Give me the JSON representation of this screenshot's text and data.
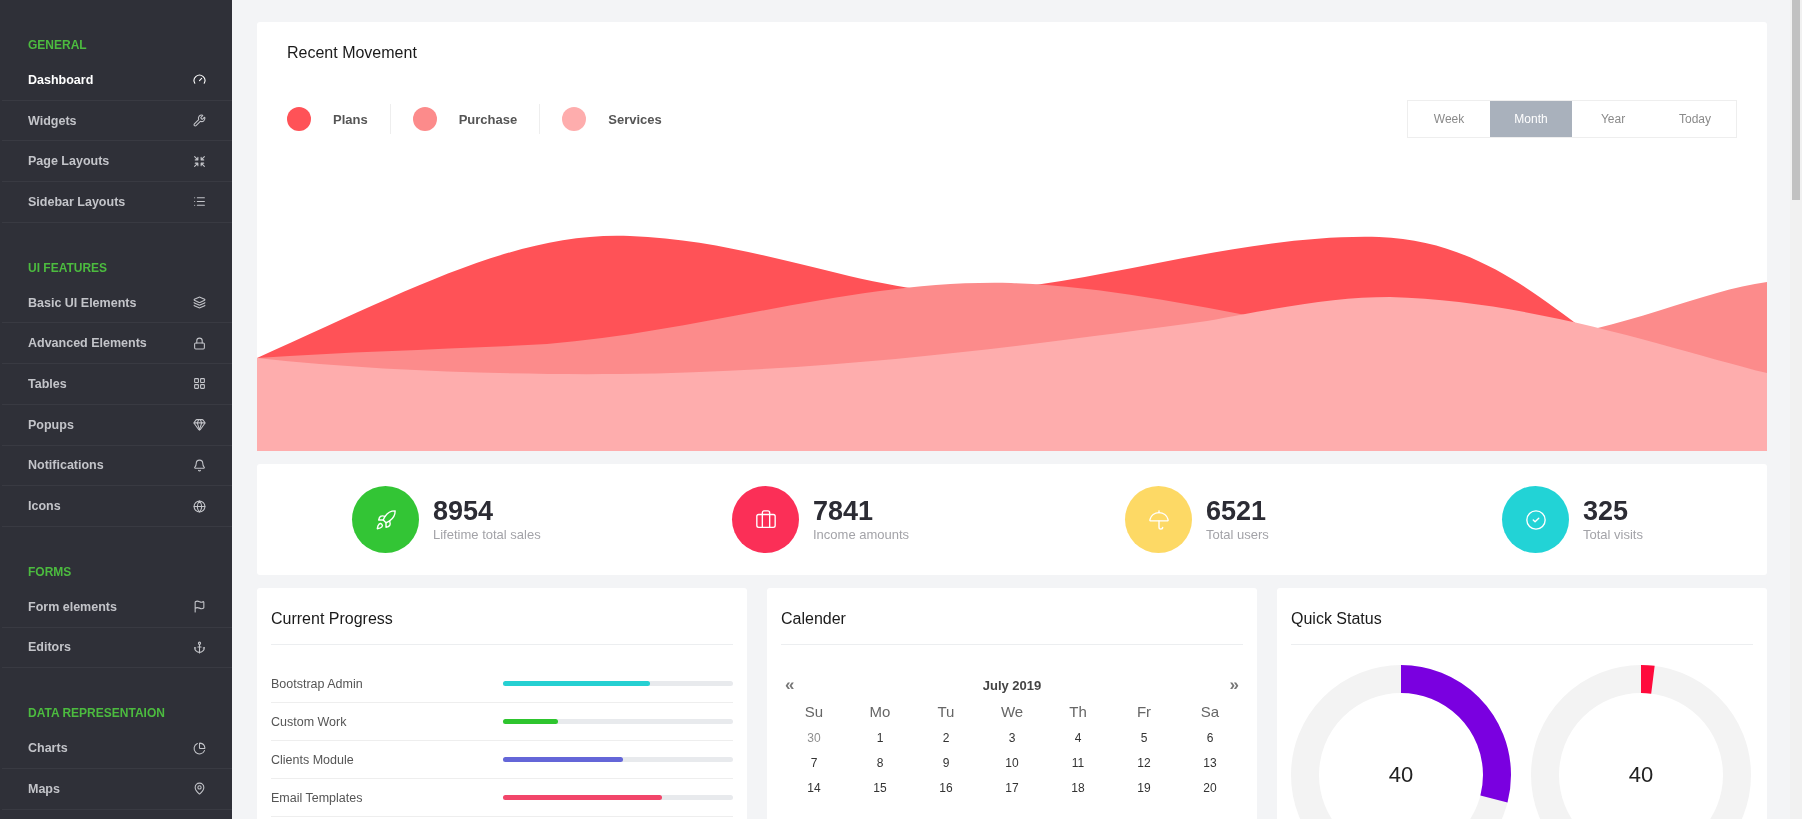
{
  "sidebar": {
    "sections": [
      {
        "title": "GENERAL",
        "items": [
          {
            "label": "Dashboard",
            "selected": true
          },
          {
            "label": "Widgets",
            "selected": false
          },
          {
            "label": "Page Layouts",
            "selected": false
          },
          {
            "label": "Sidebar Layouts",
            "selected": false
          }
        ]
      },
      {
        "title": "UI FEATURES",
        "items": [
          {
            "label": "Basic UI Elements",
            "selected": false
          },
          {
            "label": "Advanced Elements",
            "selected": false
          },
          {
            "label": "Tables",
            "selected": false
          },
          {
            "label": "Popups",
            "selected": false
          },
          {
            "label": "Notifications",
            "selected": false
          },
          {
            "label": "Icons",
            "selected": false
          }
        ]
      },
      {
        "title": "FORMS",
        "items": [
          {
            "label": "Form elements",
            "selected": false
          },
          {
            "label": "Editors",
            "selected": false
          }
        ]
      },
      {
        "title": "DATA REPRESENTAION",
        "items": [
          {
            "label": "Charts",
            "selected": false
          },
          {
            "label": "Maps",
            "selected": false
          }
        ]
      }
    ]
  },
  "movement": {
    "title": "Recent Movement",
    "legend": [
      {
        "label": "Plans",
        "color": "#ff5257"
      },
      {
        "label": "Purchase",
        "color": "#fc8b8b"
      },
      {
        "label": "Services",
        "color": "#feadad"
      }
    ],
    "periods": [
      {
        "label": "Week",
        "selected": false
      },
      {
        "label": "Month",
        "selected": true
      },
      {
        "label": "Year",
        "selected": false
      },
      {
        "label": "Today",
        "selected": false
      }
    ]
  },
  "stats": [
    {
      "value": "8954",
      "label": "Lifetime total sales",
      "color": "#33c535"
    },
    {
      "value": "7841",
      "label": "Income amounts",
      "color": "#fb2f57"
    },
    {
      "value": "6521",
      "label": "Total users",
      "color": "#fdd965"
    },
    {
      "value": "325",
      "label": "Total visits",
      "color": "#22d3d6"
    }
  ],
  "progress": {
    "title": "Current Progress",
    "items": [
      {
        "label": "Bootstrap Admin",
        "level": 0.64,
        "color": "#26d0d2"
      },
      {
        "label": "Custom Work",
        "level": 0.24,
        "color": "#2ec52e"
      },
      {
        "label": "Clients Module",
        "level": 0.52,
        "color": "#6466d8"
      },
      {
        "label": "Email Templates",
        "level": 0.69,
        "color": "#f2466a"
      }
    ]
  },
  "calendar": {
    "title": "Calender",
    "prev": "«",
    "month": "July 2019",
    "next": "»",
    "weekdays": [
      "Su",
      "Mo",
      "Tu",
      "We",
      "Th",
      "Fr",
      "Sa"
    ],
    "weeks": [
      [
        {
          "day": "30",
          "muted": true
        },
        {
          "day": "1",
          "muted": false
        },
        {
          "day": "2",
          "muted": false
        },
        {
          "day": "3",
          "muted": false
        },
        {
          "day": "4",
          "muted": false
        },
        {
          "day": "5",
          "muted": false
        },
        {
          "day": "6",
          "muted": false
        }
      ],
      [
        {
          "day": "7",
          "muted": false
        },
        {
          "day": "8",
          "muted": false
        },
        {
          "day": "9",
          "muted": false
        },
        {
          "day": "10",
          "muted": false
        },
        {
          "day": "11",
          "muted": false
        },
        {
          "day": "12",
          "muted": false
        },
        {
          "day": "13",
          "muted": false
        }
      ],
      [
        {
          "day": "14",
          "muted": false
        },
        {
          "day": "15",
          "muted": false
        },
        {
          "day": "16",
          "muted": false
        },
        {
          "day": "17",
          "muted": false
        },
        {
          "day": "18",
          "muted": false
        },
        {
          "day": "19",
          "muted": false
        },
        {
          "day": "20",
          "muted": false
        }
      ]
    ]
  },
  "quick_status": {
    "title": "Quick Status",
    "gauges": [
      {
        "value": "40",
        "level": 0.29,
        "color": "#7a00e0"
      },
      {
        "value": "40",
        "level": 0.02,
        "color": "#ff0a3c"
      }
    ]
  }
}
